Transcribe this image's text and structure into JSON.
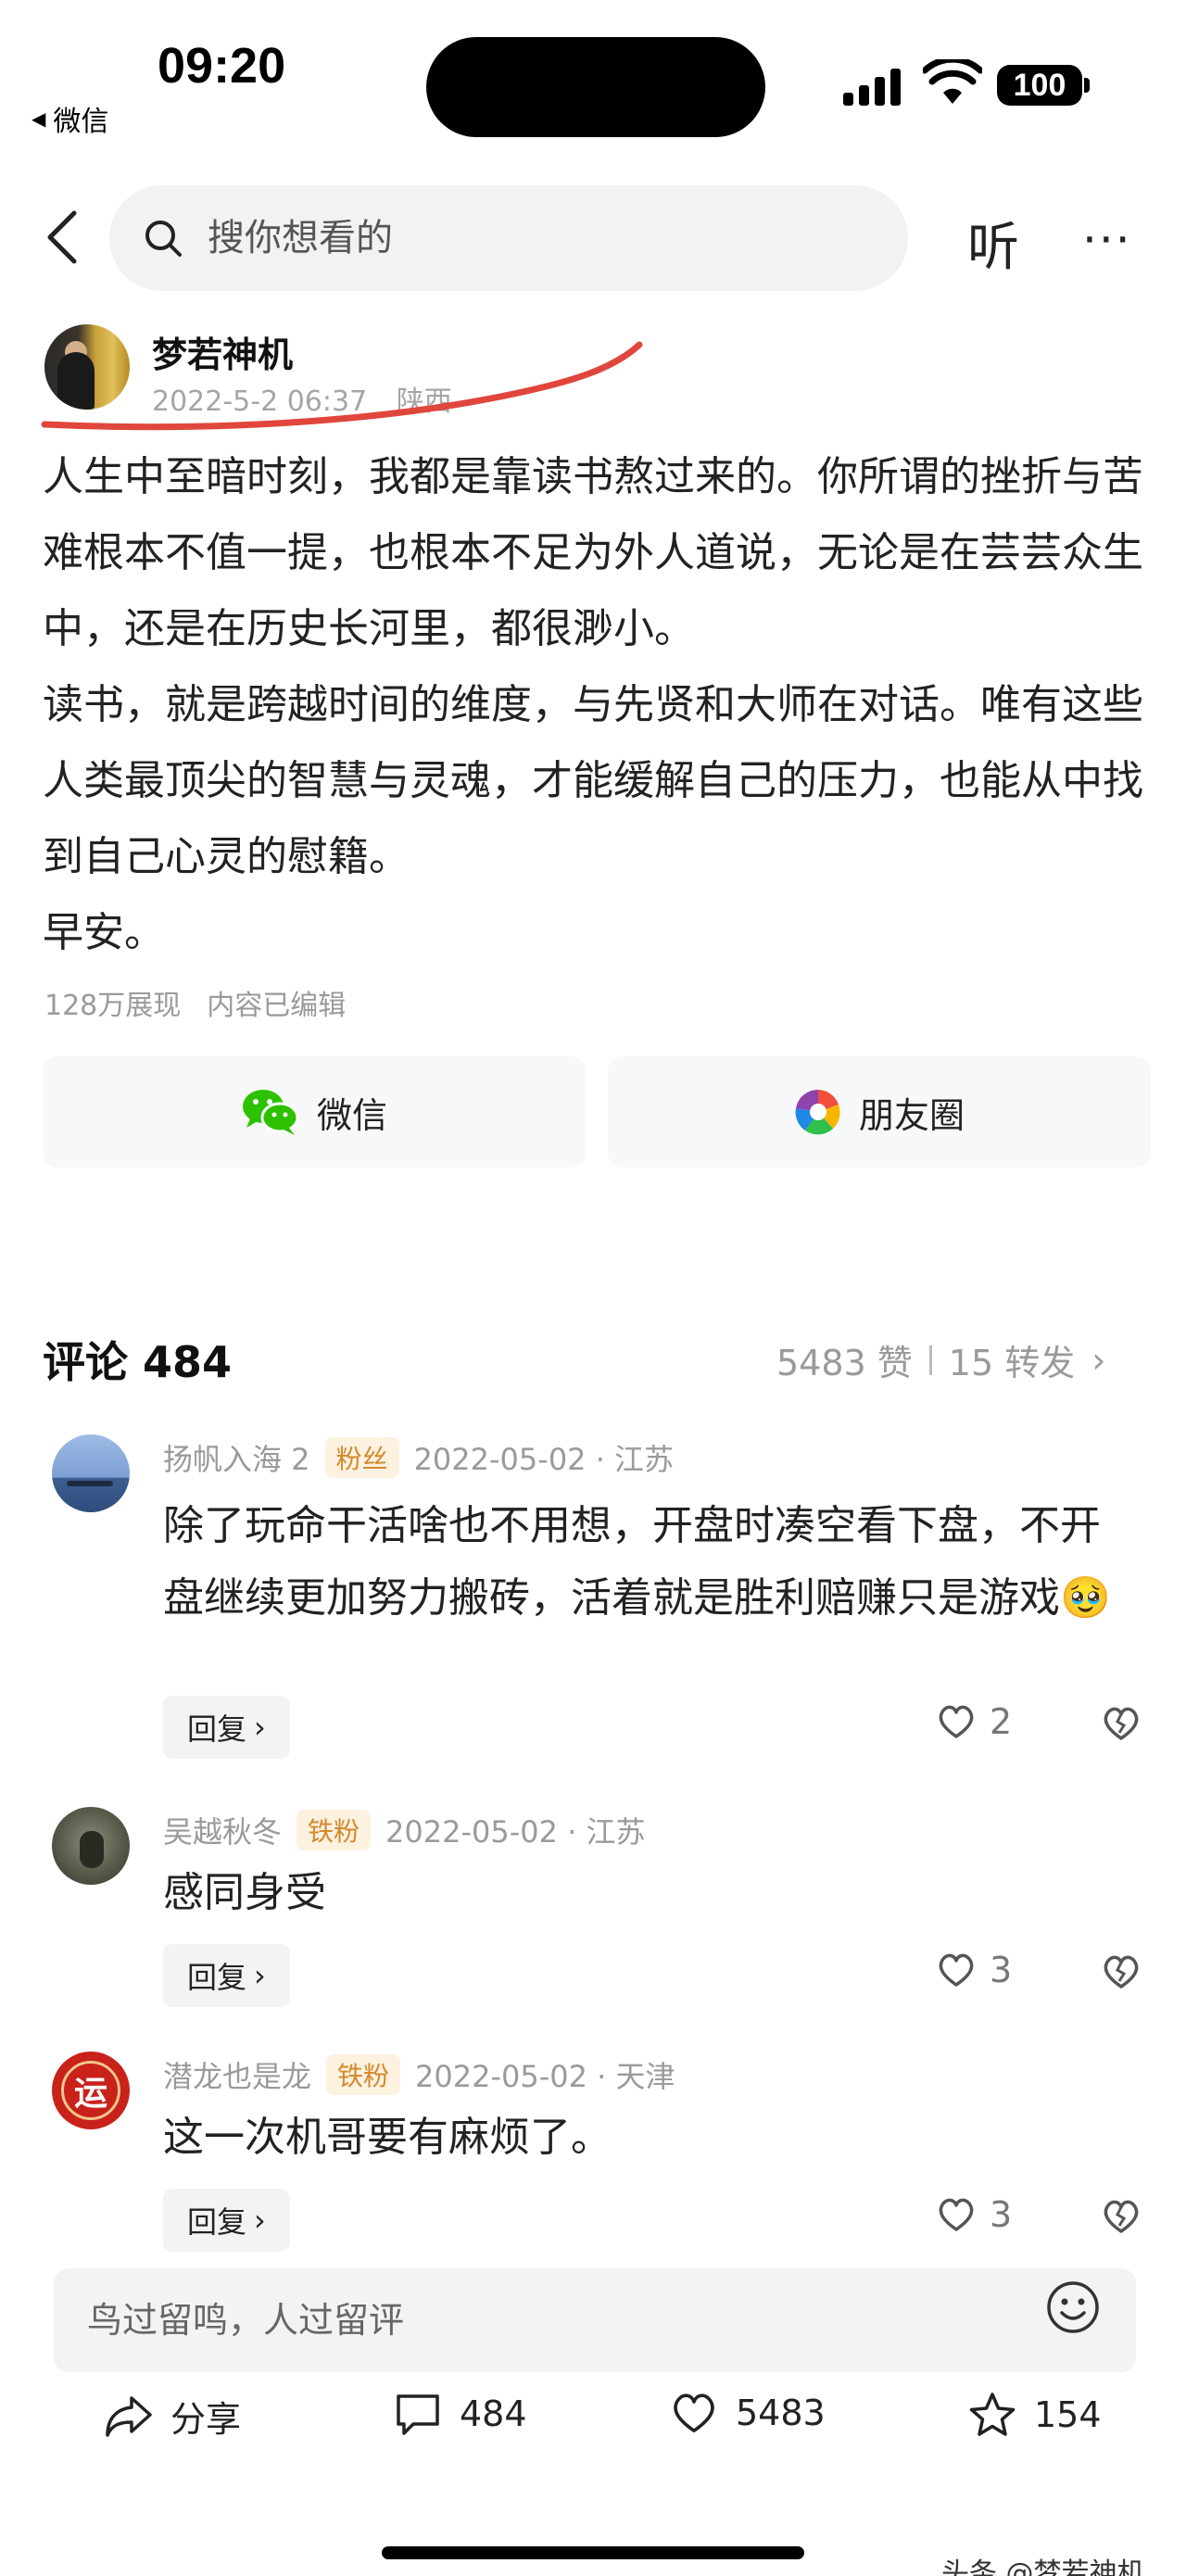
{
  "status_bar": {
    "time": "09:20",
    "back_app": "微信",
    "battery": "100"
  },
  "nav": {
    "search_placeholder": "搜你想看的",
    "listen_label": "听",
    "more_label": "···"
  },
  "author": {
    "name": "梦若神机",
    "datetime": "2022-5-2 06:37",
    "location": "陕西"
  },
  "article": {
    "paragraphs": [
      "人生中至暗时刻，我都是靠读书熬过来的。你所谓的挫折与苦难根本不值一提，也根本不足为外人道说，无论是在芸芸众生中，还是在历史长河里，都很渺小。",
      "读书，就是跨越时间的维度，与先贤和大师在对话。唯有这些人类最顶尖的智慧与灵魂，才能缓解自己的压力，也能从中找到自己心灵的慰籍。",
      "早安。"
    ],
    "views": "128万展现",
    "edited": "内容已编辑"
  },
  "share": {
    "wechat_label": "微信",
    "moments_label": "朋友圈"
  },
  "comments_header": {
    "title": "评论 484",
    "likes": "5483 赞",
    "reposts": "15 转发"
  },
  "comments": [
    {
      "user": "扬帆入海 2",
      "badge": "粉丝",
      "meta": "2022-05-02 · 江苏",
      "text": "除了玩命干活啥也不用想，开盘时凑空看下盘，不开盘继续更加努力搬砖，活着就是胜利赔赚只是游戏🥹",
      "reply_label": "回复",
      "likes": "2"
    },
    {
      "user": "吴越秋冬",
      "badge": "铁粉",
      "meta": "2022-05-02 · 江苏",
      "text": "感同身受",
      "reply_label": "回复",
      "likes": "3"
    },
    {
      "user": "潜龙也是龙",
      "badge": "铁粉",
      "meta": "2022-05-02 · 天津",
      "text": "这一次机哥要有麻烦了。",
      "reply_label": "回复",
      "likes": "3",
      "avatar_text": "运"
    }
  ],
  "bottom": {
    "input_placeholder": "鸟过留鸣，人过留评",
    "share_label": "分享",
    "comment_count": "484",
    "like_count": "5483",
    "favorite_count": "154"
  },
  "watermark": "头条 @梦若神机",
  "colors": {
    "accent_red": "#e0463c",
    "badge_text": "#d38a2b",
    "badge_bg": "#fdf1e0",
    "meta_gray": "#9a9a9a"
  }
}
